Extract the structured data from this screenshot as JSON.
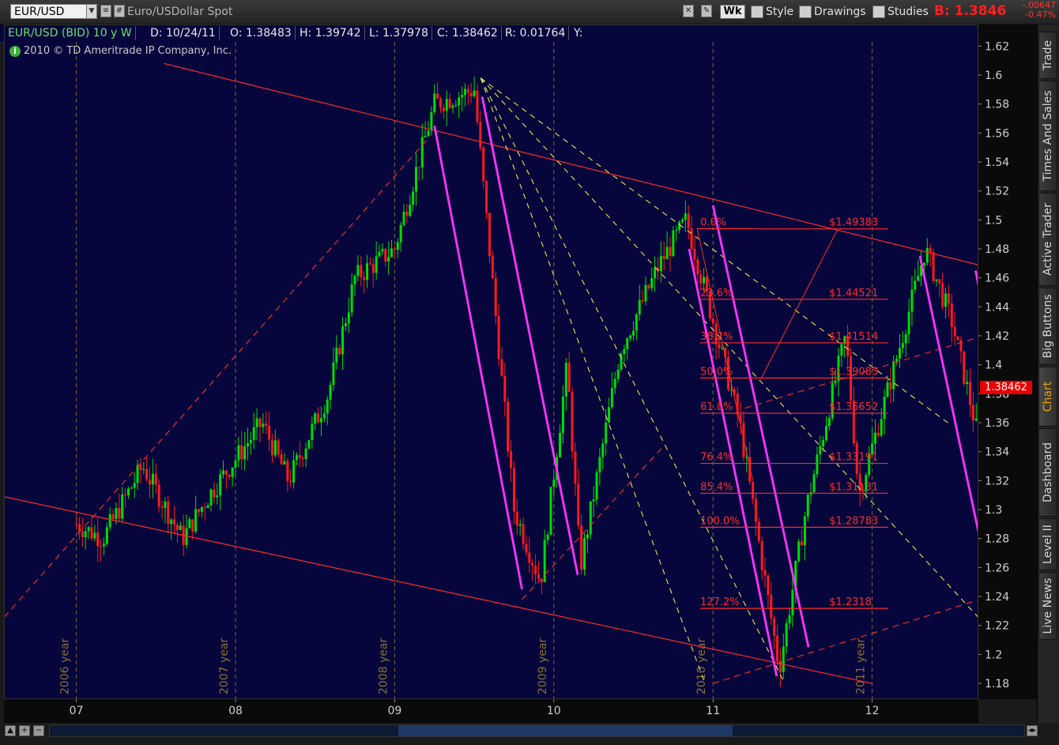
{
  "toolbar": {
    "symbol": "EUR/USD",
    "description": "Euro/USDollar Spot",
    "period": "Wk",
    "style_label": "Style",
    "drawings_label": "Drawings",
    "studies_label": "Studies",
    "bid": "B: 1.3846",
    "change": "-.00647",
    "change_pct": "-0.47%"
  },
  "infobar": {
    "title": "EUR/USD (BID) 10 y W",
    "date": "D: 10/24/11",
    "open": "O: 1.38483",
    "high": "H: 1.39742",
    "low": "L: 1.37978",
    "close": "C: 1.38462",
    "range": "R: 0.01764",
    "y": "Y:"
  },
  "copyright": "2010 © TD Ameritrade IP Company, Inc.",
  "last_price": "1.38462",
  "side_tabs": [
    "Trade",
    "Times And Sales",
    "Active Trader",
    "Big Buttons",
    "Chart",
    "Dashboard",
    "Level II",
    "Live News"
  ],
  "active_tab": "Chart",
  "colors": {
    "background": "#06063c",
    "up_candle": "#00dd00",
    "down_candle": "#ff1a1a",
    "trendline_red": "#ff2a2a",
    "trendline_yellow": "#e8e84a",
    "channel_magenta": "#ff33ff",
    "grid": "#7a6a30"
  },
  "chart_data": {
    "type": "candlestick",
    "title": "EUR/USD (BID) 10 y W",
    "ylim": [
      1.17,
      1.625
    ],
    "y_ticks": [
      1.62,
      1.6,
      1.58,
      1.56,
      1.54,
      1.52,
      1.5,
      1.48,
      1.46,
      1.44,
      1.42,
      1.4,
      1.38,
      1.36,
      1.34,
      1.32,
      1.3,
      1.28,
      1.26,
      1.24,
      1.22,
      1.2,
      1.18
    ],
    "x_ticks": [
      "07",
      "08",
      "09",
      "10",
      "11",
      "12"
    ],
    "year_labels": [
      "2006 year",
      "2007 year",
      "2008 year",
      "2009 year",
      "2010 year",
      "2011 year"
    ],
    "fibonacci": {
      "levels": [
        {
          "ratio": "0.0%",
          "price": "$1.49383",
          "value": 1.49383
        },
        {
          "ratio": "23.6%",
          "price": "$1.44521",
          "value": 1.44521
        },
        {
          "ratio": "38.2%",
          "price": "$1.41514",
          "value": 1.41514
        },
        {
          "ratio": "50.0%",
          "price": "$1.39083",
          "value": 1.39083
        },
        {
          "ratio": "61.8%",
          "price": "$1.36652",
          "value": 1.36652
        },
        {
          "ratio": "76.4%",
          "price": "$1.33191",
          "value": 1.33191
        },
        {
          "ratio": "85.4%",
          "price": "$1.31131",
          "value": 1.31131
        },
        {
          "ratio": "100.0%",
          "price": "$1.28783",
          "value": 1.28783
        },
        {
          "ratio": "127.2%",
          "price": "$1.2318",
          "value": 1.2318
        }
      ]
    },
    "price_path": [
      [
        "2006-01",
        1.29
      ],
      [
        "2006-03",
        1.28
      ],
      [
        "2006-06",
        1.33
      ],
      [
        "2006-09",
        1.28
      ],
      [
        "2006-11",
        1.31
      ],
      [
        "2007-03",
        1.36
      ],
      [
        "2007-05",
        1.32
      ],
      [
        "2007-08",
        1.38
      ],
      [
        "2007-10",
        1.46
      ],
      [
        "2008-01",
        1.48
      ],
      [
        "2008-04",
        1.58
      ],
      [
        "2008-07",
        1.59
      ],
      [
        "2008-10",
        1.3
      ],
      [
        "2008-12",
        1.25
      ],
      [
        "2009-02",
        1.4
      ],
      [
        "2009-03",
        1.26
      ],
      [
        "2009-06",
        1.41
      ],
      [
        "2009-09",
        1.47
      ],
      [
        "2009-11",
        1.5
      ],
      [
        "2010-01",
        1.43
      ],
      [
        "2010-03",
        1.36
      ],
      [
        "2010-06",
        1.19
      ],
      [
        "2010-08",
        1.3
      ],
      [
        "2010-11",
        1.42
      ],
      [
        "2010-12",
        1.31
      ],
      [
        "2011-03",
        1.41
      ],
      [
        "2011-05",
        1.48
      ],
      [
        "2011-07",
        1.43
      ],
      [
        "2011-09",
        1.35
      ],
      [
        "2011-10",
        1.38
      ]
    ]
  }
}
